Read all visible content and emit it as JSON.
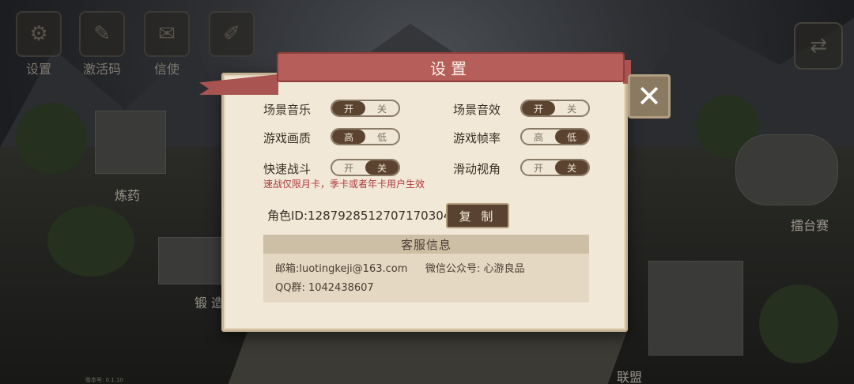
{
  "top_menu": [
    {
      "label": "设置",
      "icon": "gear-icon"
    },
    {
      "label": "激活码",
      "icon": "ticket-icon"
    },
    {
      "label": "信使",
      "icon": "scroll-icon"
    }
  ],
  "map_labels": {
    "alchemy": "炼药",
    "forge": "锻 造",
    "arena": "擂台赛",
    "alliance": "联盟"
  },
  "version_text": "版本号: 0.1.10",
  "dialog": {
    "title": "设置",
    "options": [
      {
        "label": "场景音乐",
        "on": "开",
        "off": "关",
        "active": "on"
      },
      {
        "label": "场景音效",
        "on": "开",
        "off": "关",
        "active": "on"
      },
      {
        "label": "游戏画质",
        "on": "高",
        "off": "低",
        "active": "on"
      },
      {
        "label": "游戏帧率",
        "on": "高",
        "off": "低",
        "active": "off"
      },
      {
        "label": "快速战斗",
        "on": "开",
        "off": "关",
        "active": "off"
      },
      {
        "label": "滑动视角",
        "on": "开",
        "off": "关",
        "active": "off"
      }
    ],
    "quick_battle_note": "速战仅限月卡，季卡或者年卡用户生效",
    "role_id": "角色ID:1287928512707170304",
    "copy_label": "复 制",
    "service": {
      "title": "客服信息",
      "email": "邮箱:luotingkeji@163.com",
      "wechat": "微信公众号: 心游良品",
      "qq": "QQ群: 1042438607"
    },
    "close_icon": "close-icon"
  },
  "colors": {
    "ribbon": "#b65e5a",
    "panel": "#f1e8d8",
    "toggle_active": "#5c4330",
    "note_red": "#b0393b"
  }
}
